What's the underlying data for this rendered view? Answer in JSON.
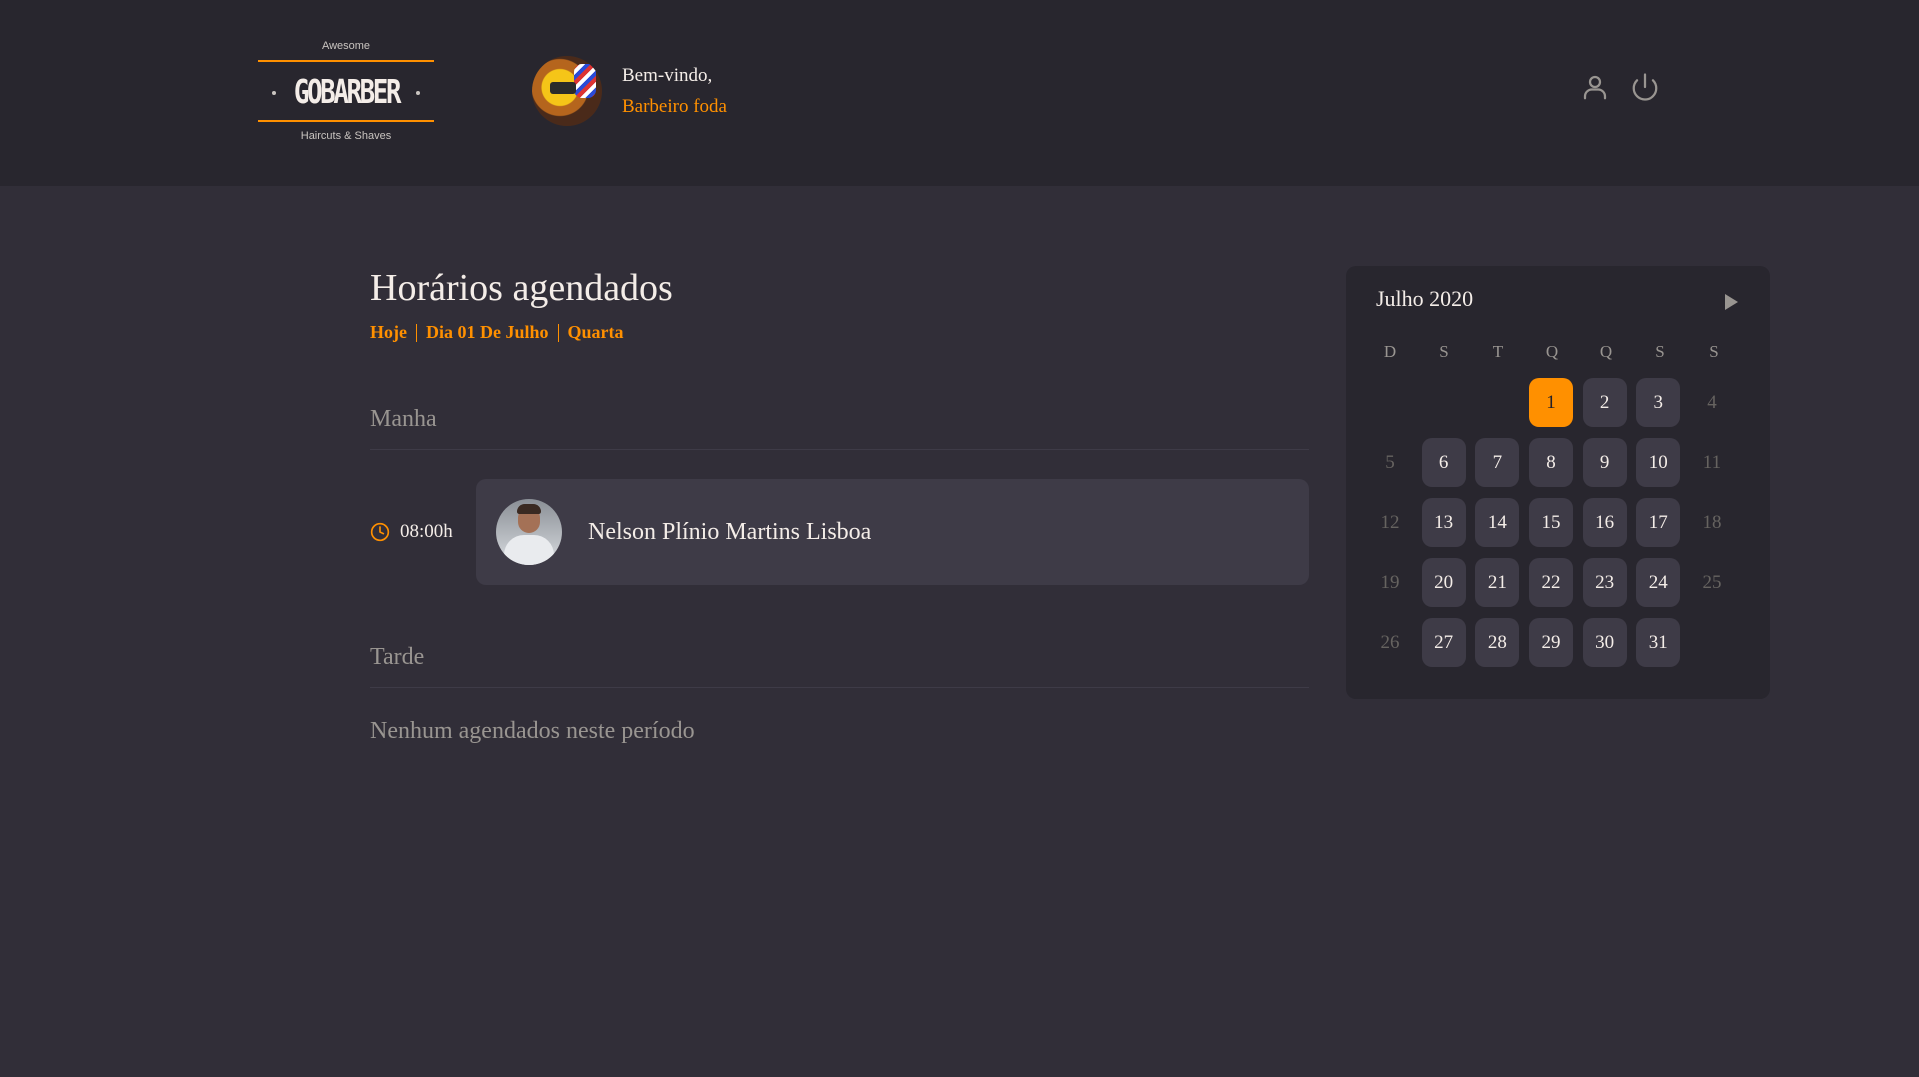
{
  "header": {
    "logo": {
      "top": "Awesome",
      "name": "GOBARBER",
      "sub": "Haircuts & Shaves"
    },
    "welcome": "Bem-vindo,",
    "user_name": "Barbeiro foda",
    "icons": [
      "user-icon",
      "power-icon"
    ]
  },
  "main": {
    "title": "Horários agendados",
    "date": {
      "today": "Hoje",
      "day": "Dia 01 De Julho",
      "weekday": "Quarta"
    },
    "morning": {
      "title": "Manha",
      "appointment": {
        "time": "08:00h",
        "client": "Nelson Plínio Martins Lisboa"
      }
    },
    "afternoon": {
      "title": "Tarde",
      "empty": "Nenhum agendados neste período"
    }
  },
  "calendar": {
    "month": "Julho 2020",
    "weekdays": [
      "D",
      "S",
      "T",
      "Q",
      "Q",
      "S",
      "S"
    ],
    "days": [
      {
        "label": "",
        "state": "blank"
      },
      {
        "label": "",
        "state": "blank"
      },
      {
        "label": "",
        "state": "blank"
      },
      {
        "label": "1",
        "state": "sel"
      },
      {
        "label": "2",
        "state": "avail"
      },
      {
        "label": "3",
        "state": "avail"
      },
      {
        "label": "4",
        "state": "off"
      },
      {
        "label": "5",
        "state": "off"
      },
      {
        "label": "6",
        "state": "avail"
      },
      {
        "label": "7",
        "state": "avail"
      },
      {
        "label": "8",
        "state": "avail"
      },
      {
        "label": "9",
        "state": "avail"
      },
      {
        "label": "10",
        "state": "avail"
      },
      {
        "label": "11",
        "state": "off"
      },
      {
        "label": "12",
        "state": "off"
      },
      {
        "label": "13",
        "state": "avail"
      },
      {
        "label": "14",
        "state": "avail"
      },
      {
        "label": "15",
        "state": "avail"
      },
      {
        "label": "16",
        "state": "avail"
      },
      {
        "label": "17",
        "state": "avail"
      },
      {
        "label": "18",
        "state": "off"
      },
      {
        "label": "19",
        "state": "off"
      },
      {
        "label": "20",
        "state": "avail"
      },
      {
        "label": "21",
        "state": "avail"
      },
      {
        "label": "22",
        "state": "avail"
      },
      {
        "label": "23",
        "state": "avail"
      },
      {
        "label": "24",
        "state": "avail"
      },
      {
        "label": "25",
        "state": "off"
      },
      {
        "label": "26",
        "state": "off"
      },
      {
        "label": "27",
        "state": "avail"
      },
      {
        "label": "28",
        "state": "avail"
      },
      {
        "label": "29",
        "state": "avail"
      },
      {
        "label": "30",
        "state": "avail"
      },
      {
        "label": "31",
        "state": "avail"
      }
    ]
  },
  "colors": {
    "accent": "#ff9000",
    "background": "#312e38",
    "header": "#28262e",
    "card": "#3e3b47",
    "text": "#f4ede8",
    "muted": "#999591"
  }
}
